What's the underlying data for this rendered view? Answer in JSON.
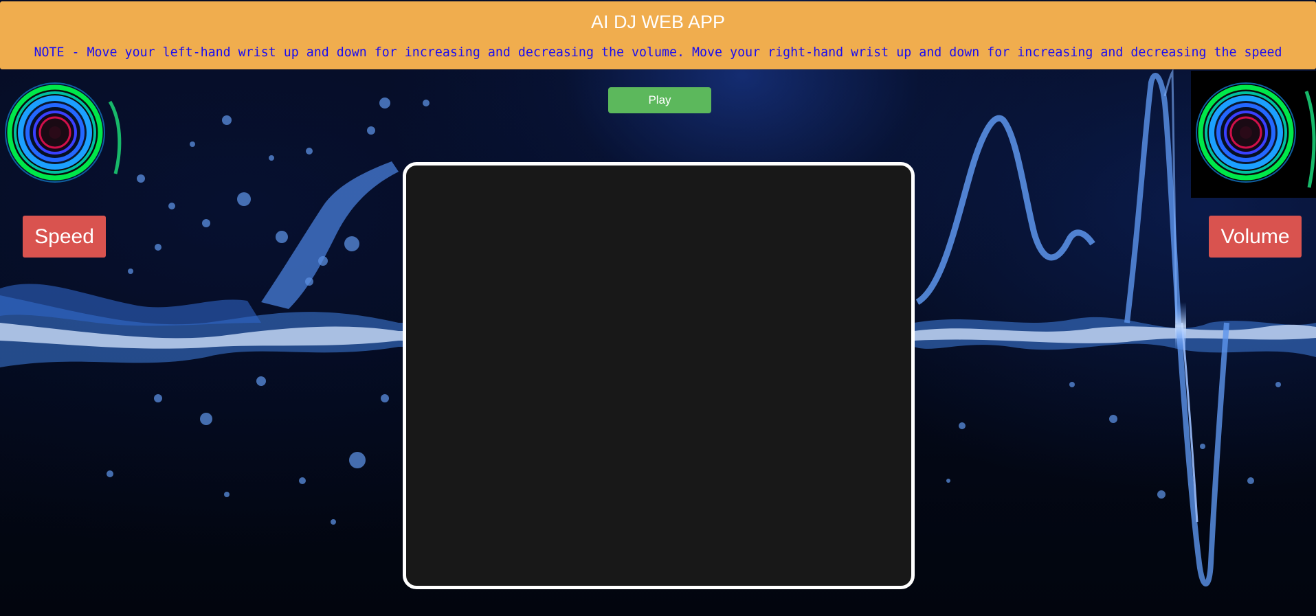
{
  "header": {
    "title": "AI DJ WEB APP",
    "note": "NOTE - Move your left-hand wrist up and down for increasing and decreasing the volume. Move your right-hand wrist up and down for increasing and decreasing the speed"
  },
  "controls": {
    "play_label": "Play",
    "speed_label": "Speed",
    "volume_label": "Volume"
  },
  "icons": {
    "left_deck": "turntable-icon",
    "right_deck": "turntable-icon"
  },
  "colors": {
    "header_bg": "#f0ad4e",
    "note_text": "#1a0df0",
    "play_button": "#5cb85c",
    "side_buttons": "#d9534f",
    "video_area": "#181818"
  }
}
